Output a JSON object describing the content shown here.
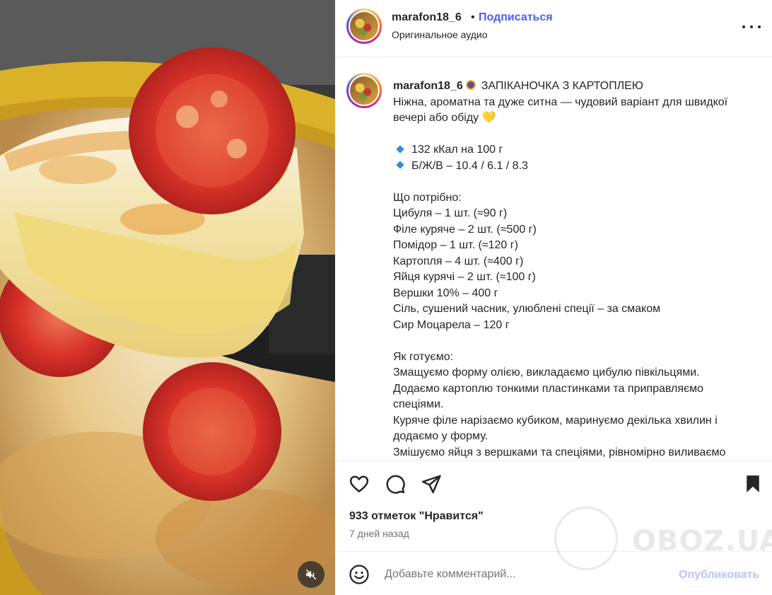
{
  "header": {
    "username": "marafon18_6",
    "separator": "•",
    "follow_label": "Подписаться",
    "audio_label": "Оригинальное аудио"
  },
  "caption": {
    "username": "marafon18_6",
    "title": "ЗАПІКАНОЧКА З КАРТОПЛЕЮ",
    "intro_1": "Ніжна, ароматна та дуже ситна — чудовий варіант для швидкої",
    "intro_2": "вечері або обіду",
    "intro_emoji": "💛",
    "nutrition": [
      "132 кКал на 100 г",
      "Б/Ж/В – 10.4 / 6.1 / 8.3"
    ],
    "ingredients_title": "Що потрібно:",
    "ingredients": [
      "Цибуля – 1 шт. (≈90 г)",
      "Філе куряче – 2 шт. (≈500 г)",
      "Помідор – 1 шт. (≈120 г)",
      "Картопля – 4 шт. (≈400 г)",
      "Яйця курячі – 2 шт. (≈100 г)",
      "Вершки 10% – 400 г",
      "Сіль, сушений часник, улюблені спеції – за смаком",
      "Сир Моцарела – 120 г"
    ],
    "steps_title": "Як готуємо:",
    "steps": [
      "Змащуємо форму олією, викладаємо цибулю півкільцями.",
      "Додаємо картоплю тонкими пластинками та приправляємо",
      "спеціями.",
      "Куряче філе нарізаємо кубиком, маринуємо декілька хвилин і",
      "додаємо у форму.",
      "Змішуємо яйця з вершками та спеціями, рівномірно виливаємо"
    ]
  },
  "actions": {
    "likes": "933 отметок \"Нравится\"",
    "time": "7 дней назад"
  },
  "comment": {
    "placeholder": "Добавьте комментарий...",
    "publish_label": "Опубликовать"
  },
  "watermark": {
    "text": "OBOZ.UA"
  },
  "colors": {
    "follow": "#4a5df9",
    "publish_disabled": "#b6c4f8",
    "text": "#262626",
    "muted": "#737373"
  }
}
